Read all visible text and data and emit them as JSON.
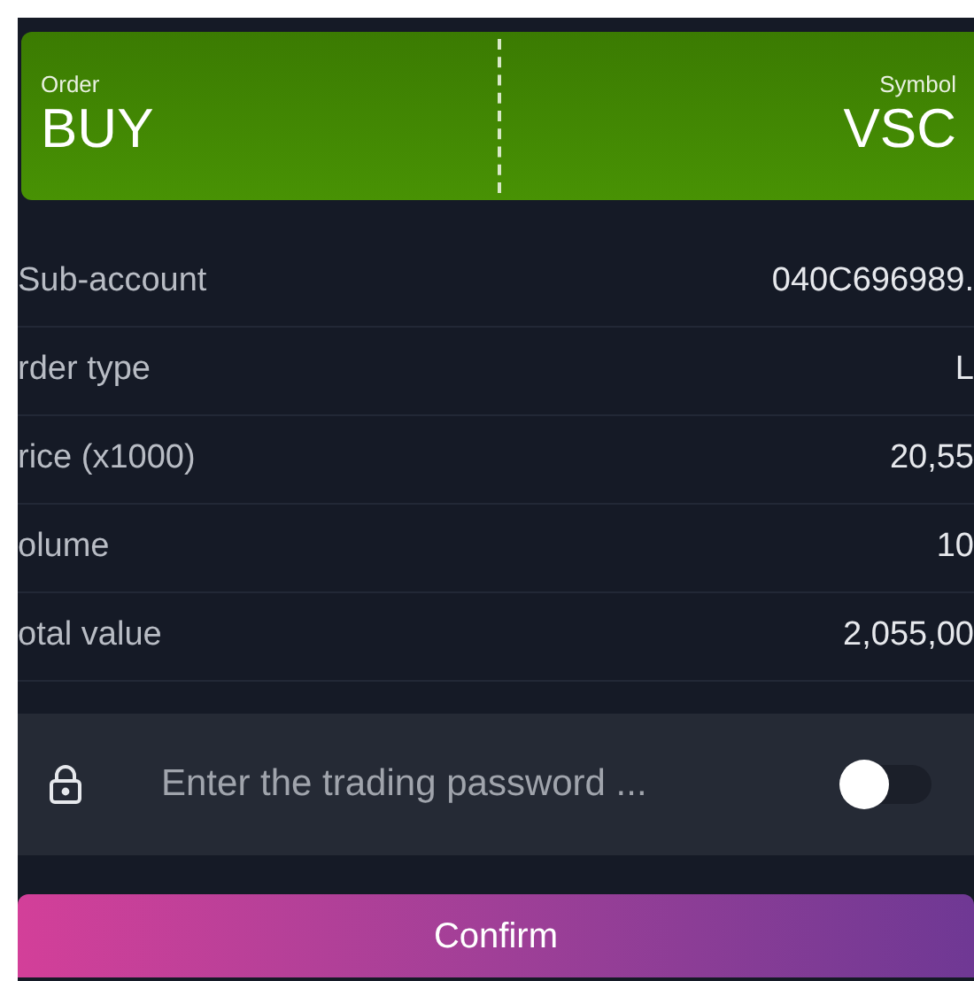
{
  "header": {
    "order_label": "Order",
    "order_value": "BUY",
    "symbol_label": "Symbol",
    "symbol_value": "VSC"
  },
  "rows": [
    {
      "label": "Sub-account",
      "value": "040C696989."
    },
    {
      "label": "rder type",
      "value": "L"
    },
    {
      "label": "rice (x1000)",
      "value": "20,55"
    },
    {
      "label": "olume",
      "value": "10"
    },
    {
      "label": "otal value",
      "value": "2,055,00"
    }
  ],
  "password": {
    "placeholder": "Enter the trading password ...",
    "show_toggle": {
      "on": false
    }
  },
  "confirm_button": "Confirm"
}
